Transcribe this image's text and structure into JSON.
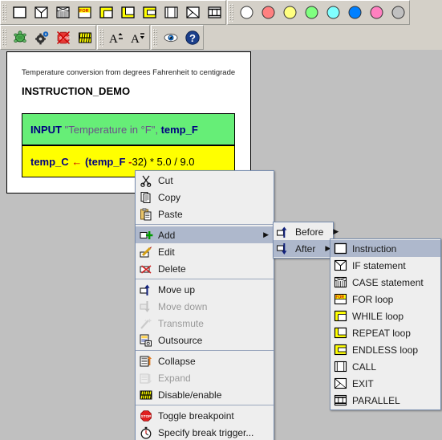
{
  "window": {
    "background_color": "#c0c0c0"
  },
  "toolbars": [
    {
      "name": "elements-toolbar",
      "buttons": [
        {
          "icon": "instruction-box-icon",
          "tooltip": "Instruction"
        },
        {
          "icon": "if-statement-icon",
          "tooltip": "IF statement"
        },
        {
          "icon": "case-statement-icon",
          "tooltip": "CASE statement"
        },
        {
          "icon": "for-loop-icon",
          "tooltip": "FOR loop"
        },
        {
          "icon": "while-loop-icon",
          "tooltip": "WHILE loop"
        },
        {
          "icon": "repeat-loop-icon",
          "tooltip": "REPEAT loop"
        },
        {
          "icon": "endless-loop-icon",
          "tooltip": "ENDLESS loop"
        },
        {
          "icon": "call-icon",
          "tooltip": "CALL"
        },
        {
          "icon": "exit-icon",
          "tooltip": "EXIT"
        },
        {
          "icon": "parallel-icon",
          "tooltip": "PARALLEL"
        }
      ]
    },
    {
      "name": "colors-toolbar",
      "colors": [
        "#ffffff",
        "#ff8080",
        "#ffff80",
        "#80ff80",
        "#80ffff",
        "#0080ff",
        "#ff80c0",
        "#c0c0c0"
      ]
    },
    {
      "name": "run-toolbar",
      "buttons": [
        {
          "icon": "turtleizer-icon",
          "tooltip": "Turtleizer"
        },
        {
          "icon": "executor-gear-icon",
          "tooltip": "Executor"
        },
        {
          "icon": "drop-breakpoints-icon",
          "tooltip": "Clear breakpoints"
        },
        {
          "icon": "disable-enable-icon",
          "tooltip": "Disable/enable"
        }
      ]
    },
    {
      "name": "font-toolbar",
      "buttons": [
        {
          "icon": "font-increase-icon",
          "label": "A",
          "tooltip": "Enlarge font"
        },
        {
          "icon": "font-decrease-icon",
          "label": "A",
          "tooltip": "Reduce font"
        }
      ]
    },
    {
      "name": "view-toolbar",
      "buttons": [
        {
          "icon": "eye-icon",
          "tooltip": "Show comments"
        },
        {
          "icon": "help-icon",
          "tooltip": "Help"
        }
      ]
    }
  ],
  "diagram": {
    "comment": "Temperature conversion from degrees Fahrenheit to centigrade",
    "title": "INSTRUCTION_DEMO",
    "elements": [
      {
        "type": "input",
        "color": "#66ee77",
        "keyword": "INPUT",
        "string": "\"Temperature in °F\",",
        "variable": "temp_F",
        "text": "INPUT \"Temperature in °F\", temp_F"
      },
      {
        "type": "assignment",
        "color": "#ffff00",
        "lhs": "temp_C",
        "arrow": "←",
        "rhs_bold": "(temp_F",
        "rhs_dash": "-",
        "rhs_rest": "32) * 5.0 / 9.0",
        "text": "temp_C ← (temp_F - 32) * 5.0 / 9.0"
      }
    ]
  },
  "context_menu": {
    "name": "element-context-menu",
    "groups": [
      [
        {
          "id": "cut",
          "label": "Cut",
          "icon": "scissors-icon",
          "enabled": true,
          "selected": false,
          "submenu": false
        },
        {
          "id": "copy",
          "label": "Copy",
          "icon": "copy-icon",
          "enabled": true,
          "selected": false,
          "submenu": false
        },
        {
          "id": "paste",
          "label": "Paste",
          "icon": "clipboard-paste-icon",
          "enabled": true,
          "selected": false,
          "submenu": false
        }
      ],
      [
        {
          "id": "add",
          "label": "Add",
          "icon": "add-green-plus-icon",
          "enabled": true,
          "selected": true,
          "submenu": true
        },
        {
          "id": "edit",
          "label": "Edit",
          "icon": "pencil-edit-icon",
          "enabled": true,
          "selected": false,
          "submenu": false
        },
        {
          "id": "delete",
          "label": "Delete",
          "icon": "delete-red-x-icon",
          "enabled": true,
          "selected": false,
          "submenu": false
        }
      ],
      [
        {
          "id": "move-up",
          "label": "Move up",
          "icon": "move-up-arrow-icon",
          "enabled": true,
          "selected": false,
          "submenu": false
        },
        {
          "id": "move-down",
          "label": "Move down",
          "icon": "move-down-arrow-icon",
          "enabled": false,
          "selected": false,
          "submenu": false
        },
        {
          "id": "transmute",
          "label": "Transmute",
          "icon": "transmute-wand-icon",
          "enabled": false,
          "selected": false,
          "submenu": false
        },
        {
          "id": "outsource",
          "label": "Outsource",
          "icon": "outsource-icon",
          "enabled": true,
          "selected": false,
          "submenu": false
        }
      ],
      [
        {
          "id": "collapse",
          "label": "Collapse",
          "icon": "collapse-icon",
          "enabled": true,
          "selected": false,
          "submenu": false
        },
        {
          "id": "expand",
          "label": "Expand",
          "icon": "expand-icon",
          "enabled": false,
          "selected": false,
          "submenu": false
        },
        {
          "id": "disable-enable",
          "label": "Disable/enable",
          "icon": "disable-enable-icon",
          "enabled": true,
          "selected": false,
          "submenu": false
        }
      ],
      [
        {
          "id": "toggle-breakpoint",
          "label": "Toggle breakpoint",
          "icon": "stop-sign-icon",
          "enabled": true,
          "selected": false,
          "submenu": false
        },
        {
          "id": "specify-break-trigger",
          "label": "Specify break trigger...",
          "icon": "stopwatch-icon",
          "enabled": true,
          "selected": false,
          "submenu": false
        }
      ]
    ]
  },
  "add_submenu": {
    "name": "add-position-submenu",
    "items": [
      {
        "id": "before",
        "label": "Before",
        "icon": "insert-before-icon",
        "selected": false,
        "submenu": true
      },
      {
        "id": "after",
        "label": "After",
        "icon": "insert-after-icon",
        "selected": true,
        "submenu": true
      }
    ]
  },
  "type_submenu": {
    "name": "add-element-type-submenu",
    "items": [
      {
        "id": "instruction",
        "label": "Instruction",
        "icon": "instruction-box-icon",
        "selected": true
      },
      {
        "id": "if-statement",
        "label": "IF statement",
        "icon": "if-statement-icon",
        "selected": false
      },
      {
        "id": "case-statement",
        "label": "CASE statement",
        "icon": "case-statement-icon",
        "selected": false
      },
      {
        "id": "for-loop",
        "label": "FOR loop",
        "icon": "for-loop-icon",
        "selected": false
      },
      {
        "id": "while-loop",
        "label": "WHILE loop",
        "icon": "while-loop-icon",
        "selected": false
      },
      {
        "id": "repeat-loop",
        "label": "REPEAT loop",
        "icon": "repeat-loop-icon",
        "selected": false
      },
      {
        "id": "endless-loop",
        "label": "ENDLESS loop",
        "icon": "endless-loop-icon",
        "selected": false
      },
      {
        "id": "call",
        "label": "CALL",
        "icon": "call-icon",
        "selected": false
      },
      {
        "id": "exit",
        "label": "EXIT",
        "icon": "exit-icon",
        "selected": false
      },
      {
        "id": "parallel",
        "label": "PARALLEL",
        "icon": "parallel-icon",
        "selected": false
      }
    ]
  },
  "colors": {
    "menu_highlight": "#aeb8cc",
    "menu_background": "#eeeeee",
    "menu_border": "#7a8fb0",
    "canvas_background": "#c0c0c0",
    "toolbar_background": "#d4d0c8"
  }
}
